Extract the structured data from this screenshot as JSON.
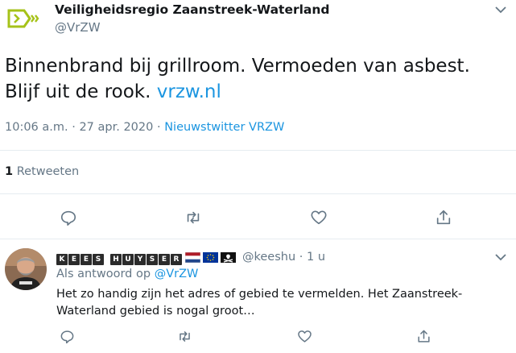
{
  "tweet": {
    "author": {
      "name": "Veiligheidsregio Zaanstreek-Waterland",
      "handle": "@VrZW",
      "logo_icon": "vrzw-logo-icon",
      "logo_color": "#a6c219"
    },
    "text": "Binnenbrand bij grillroom. Vermoeden van asbest. Blijf uit de rook.",
    "link": "vrzw.nl",
    "time": "10:06 a.m.",
    "date": "27 apr. 2020",
    "source": "Nieuwstwitter VRZW",
    "separator": "·",
    "stats": {
      "retweet_count": "1",
      "retweet_label": "Retweeten"
    },
    "actions": [
      "reply-icon",
      "retweet-icon",
      "like-icon",
      "share-icon"
    ]
  },
  "reply": {
    "name_letters": [
      "K",
      "E",
      "E",
      "S",
      "H",
      "U",
      "Y",
      "S",
      "E",
      "R"
    ],
    "flags": [
      "netherlands-flag",
      "eu-flag",
      "jolly-roger-flag"
    ],
    "handle": "@keeshu",
    "separator": "·",
    "time_ago": "1 u",
    "reply_to_label": "Als antwoord op",
    "reply_to_handle": "@VrZW",
    "text": "Het zo handig zijn het adres of gebied te vermelden. Het Zaanstreek-Waterland gebied is nogal groot…",
    "actions": [
      "reply-icon",
      "retweet-icon",
      "like-icon",
      "share-icon"
    ]
  },
  "colors": {
    "link": "#1b95e0",
    "secondary_text": "#657786",
    "primary_text": "#14171a",
    "divider": "#e6ecf0"
  }
}
